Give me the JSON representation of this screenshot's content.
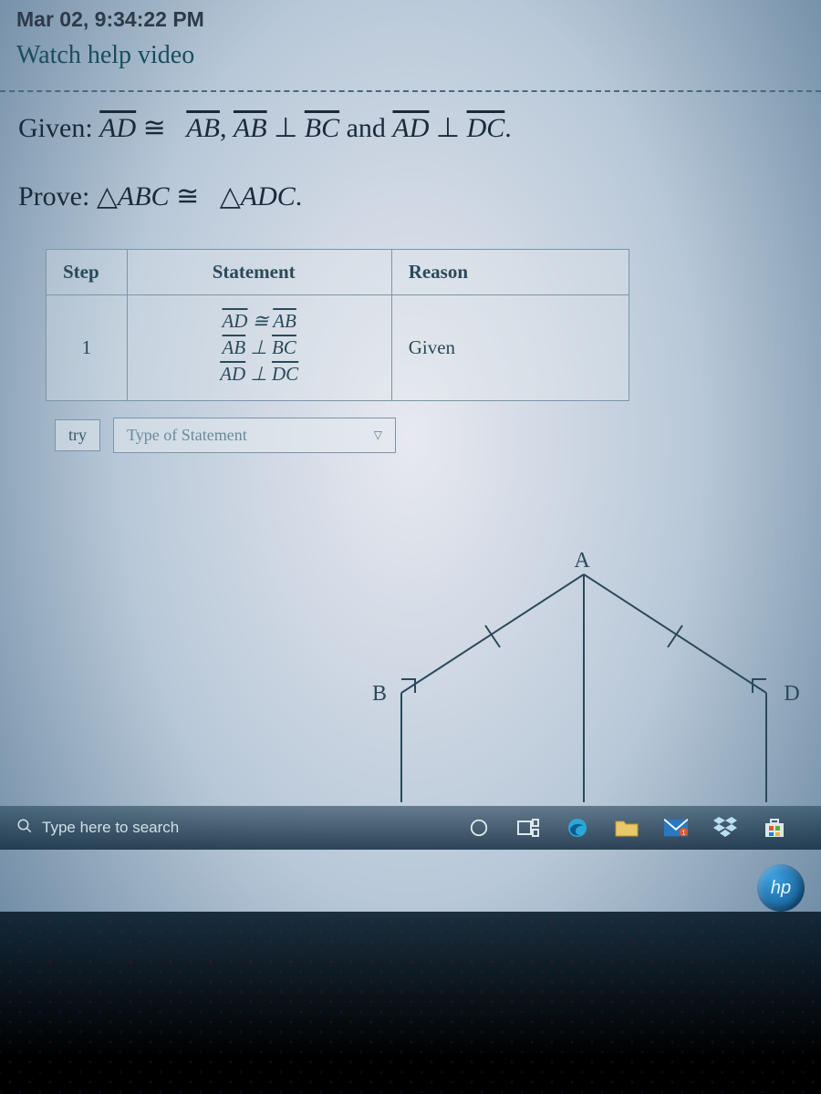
{
  "header": {
    "timestamp": "Mar 02, 9:34:22 PM",
    "help_link": "Watch help video"
  },
  "problem": {
    "given_label": "Given:",
    "given_expr_parts": {
      "ad": "AD",
      "ab": "AB",
      "bc": "BC",
      "dc": "DC",
      "cong": "≅",
      "perp": "⊥",
      "and": "and",
      "comma": ","
    },
    "given_text": "AD ≅ AB, AB ⊥ BC and AD ⊥ DC.",
    "prove_label": "Prove:",
    "prove_expr_parts": {
      "tri": "△",
      "abc": "ABC",
      "adc": "ADC",
      "cong": "≅"
    },
    "prove_text": "△ABC ≅ △ADC."
  },
  "table": {
    "headers": {
      "step": "Step",
      "statement": "Statement",
      "reason": "Reason"
    },
    "rows": [
      {
        "step": "1",
        "statements": [
          "AD ≅ AB",
          "AB ⊥ BC",
          "AD ⊥ DC"
        ],
        "reason": "Given"
      }
    ]
  },
  "controls": {
    "try_label": "try",
    "type_placeholder": "Type of Statement"
  },
  "diagram": {
    "labels": {
      "A": "A",
      "B": "B",
      "D": "D"
    }
  },
  "taskbar": {
    "search_placeholder": "Type here to search",
    "icons": [
      "cortana-icon",
      "taskview-icon",
      "edge-icon",
      "fileexplorer-icon",
      "mail-icon",
      "dropbox-icon",
      "msstore-icon"
    ]
  },
  "badge": {
    "hp": "hp"
  }
}
